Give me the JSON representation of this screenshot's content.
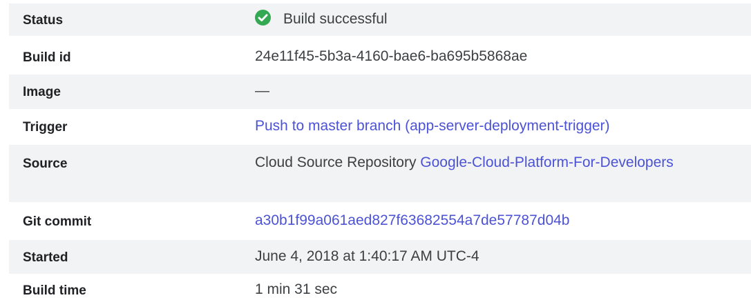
{
  "rows": {
    "status": {
      "label": "Status",
      "icon": "check-circle-icon",
      "icon_color": "#34a853",
      "value": "Build successful"
    },
    "build_id": {
      "label": "Build id",
      "value": "24e11f45-5b3a-4160-bae6-ba695b5868ae"
    },
    "image": {
      "label": "Image",
      "value": "—"
    },
    "trigger": {
      "label": "Trigger",
      "link": "Push to master branch (app-server-deployment-trigger)"
    },
    "source": {
      "label": "Source",
      "prefix": "Cloud Source Repository ",
      "link": "Google-Cloud-Platform-For-Developers"
    },
    "git_commit": {
      "label": "Git commit",
      "link": "a30b1f99a061aed827f63682554a7de57787d04b"
    },
    "started": {
      "label": "Started",
      "value": "June 4, 2018 at 1:40:17 AM UTC-4"
    },
    "build_time": {
      "label": "Build time",
      "value": "1 min 31 sec"
    }
  },
  "colors": {
    "link": "#4c52d6",
    "row_shade": "#f1f3f4",
    "success": "#34a853"
  }
}
